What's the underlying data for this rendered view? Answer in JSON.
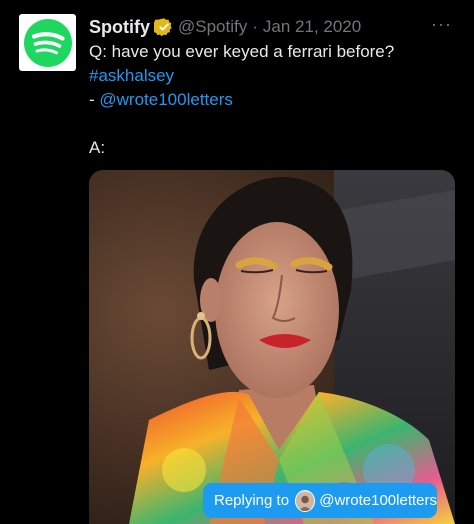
{
  "tweet": {
    "author_name": "Spotify",
    "handle": "@Spotify",
    "separator": "·",
    "date": "Jan 21, 2020",
    "more_label": "···",
    "lines": {
      "question": "Q: have you ever keyed a ferrari before?",
      "hashtag": "#askhalsey",
      "signature_prefix": "- ",
      "signature_mention": "@wrote100letters",
      "answer": "A:"
    }
  },
  "icons": {
    "avatar": "spotify-logo",
    "verified": "verified-badge-icon",
    "pill_avatar": "user-avatar"
  },
  "media": {
    "description_alt": "video thumbnail",
    "reply_pill": {
      "prefix": "Replying to",
      "mention": "@wrote100letters"
    }
  },
  "colors": {
    "background": "#000000",
    "text": "#e7e9ea",
    "muted": "#71767b",
    "link": "#1d9bf0",
    "spotify_green": "#1ed760",
    "verified_gold": "#e2b719"
  }
}
